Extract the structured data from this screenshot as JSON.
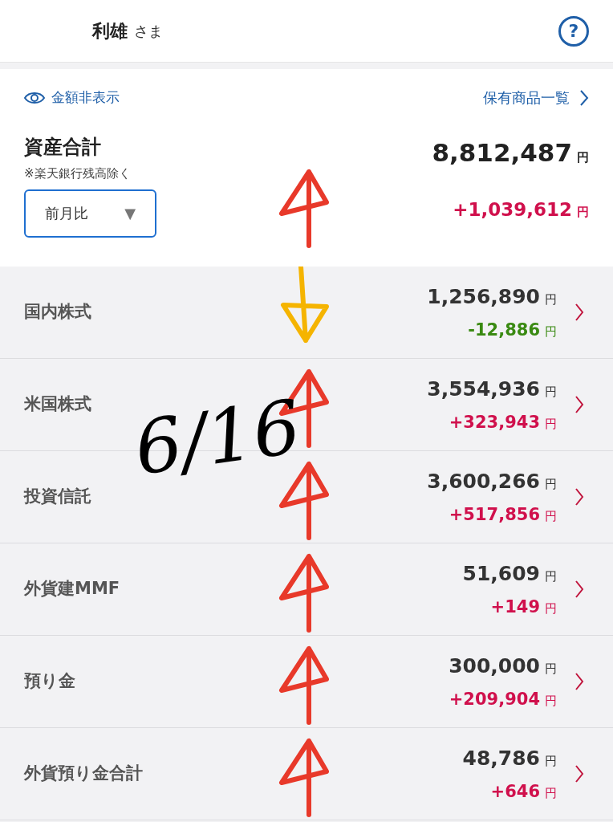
{
  "header": {
    "name": "利雄",
    "honorific": "さま",
    "help": "?"
  },
  "summary": {
    "hide_amounts": "金額非表示",
    "holdings_link": "保有商品一覧",
    "title": "資産合計",
    "note": "※楽天銀行残高除く",
    "period": "前月比",
    "period_caret": "▼",
    "total": "8,812,487",
    "total_unit": "円",
    "change": "+1,039,612",
    "change_unit": "円",
    "kind": "gain"
  },
  "rows": [
    {
      "label": "国内株式",
      "value": "1,256,890",
      "value_unit": "円",
      "change": "-12,886",
      "change_unit": "円",
      "kind": "loss"
    },
    {
      "label": "米国株式",
      "value": "3,554,936",
      "value_unit": "円",
      "change": "+323,943",
      "change_unit": "円",
      "kind": "gain"
    },
    {
      "label": "投資信託",
      "value": "3,600,266",
      "value_unit": "円",
      "change": "+517,856",
      "change_unit": "円",
      "kind": "gain"
    },
    {
      "label": "外貨建MMF",
      "value": "51,609",
      "value_unit": "円",
      "change": "+149",
      "change_unit": "円",
      "kind": "gain"
    },
    {
      "label": "預り金",
      "value": "300,000",
      "value_unit": "円",
      "change": "+209,904",
      "change_unit": "円",
      "kind": "gain"
    },
    {
      "label": "外貨預り金合計",
      "value": "48,786",
      "value_unit": "円",
      "change": "+646",
      "change_unit": "円",
      "kind": "gain"
    }
  ],
  "annotations": {
    "note": "6/16",
    "marks": [
      {
        "kind": "up",
        "color": "#e8392a"
      },
      {
        "kind": "down",
        "color": "#f5b400"
      },
      {
        "kind": "up",
        "color": "#e8392a"
      },
      {
        "kind": "up",
        "color": "#e8392a"
      },
      {
        "kind": "up",
        "color": "#e8392a"
      },
      {
        "kind": "up",
        "color": "#e8392a"
      },
      {
        "kind": "up",
        "color": "#e8392a"
      }
    ]
  }
}
